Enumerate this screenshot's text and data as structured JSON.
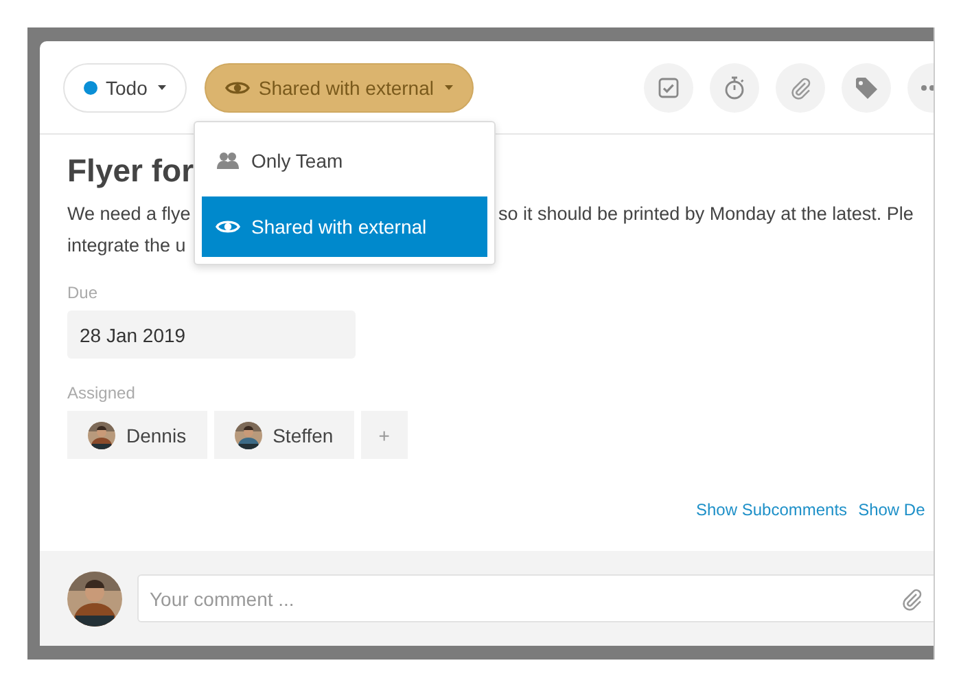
{
  "status": {
    "label": "Todo",
    "color": "#0a8fd6"
  },
  "visibility": {
    "label": "Shared with external"
  },
  "toolbar": [
    {
      "kind": "checklist"
    },
    {
      "kind": "timer"
    },
    {
      "kind": "attach"
    },
    {
      "kind": "tag"
    },
    {
      "kind": "more"
    }
  ],
  "visibility_menu": [
    {
      "kind": "team",
      "label": "Only Team",
      "selected": false
    },
    {
      "kind": "external",
      "label": "Shared with external",
      "selected": true
    }
  ],
  "title": "Flyer for",
  "description": {
    "line_1_start": "We need a flye",
    "line_1_end": "so it should be printed by Monday at the latest. Ple",
    "line_2": "integrate the u"
  },
  "due": {
    "label": "Due",
    "value": "28 Jan 2019"
  },
  "assigned": {
    "label": "Assigned",
    "people": [
      {
        "name": "Dennis"
      },
      {
        "name": "Steffen"
      }
    ],
    "add": "+"
  },
  "links": [
    "Show Subcomments",
    "Show De"
  ],
  "comment": {
    "placeholder": "Your comment ..."
  }
}
